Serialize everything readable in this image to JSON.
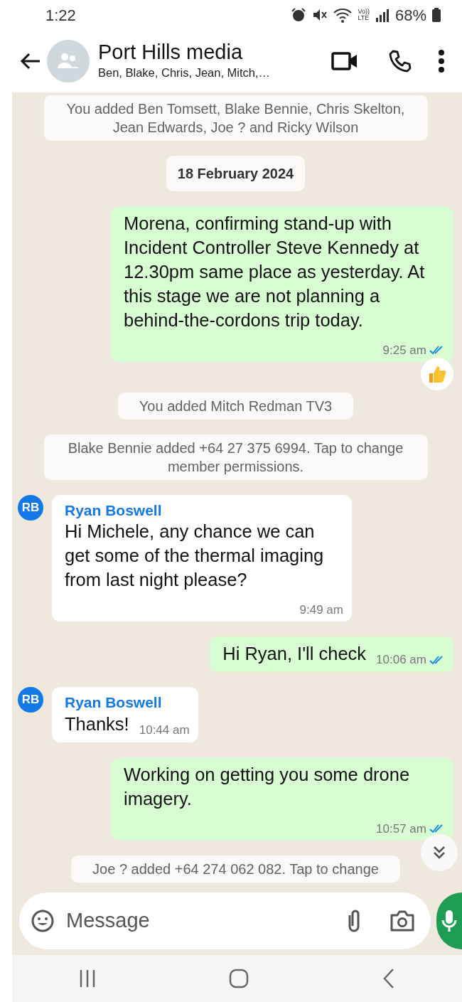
{
  "status_bar": {
    "time": "1:22",
    "network": [
      "Vo))",
      "LTE"
    ],
    "battery": "68%"
  },
  "header": {
    "title": "Port Hills media",
    "subtitle": "Ben, Blake, Chris, Jean, Mitch,…"
  },
  "messages": [
    {
      "kind": "system",
      "text": "You added Ben Tomsett, Blake Bennie, Chris Skelton, Jean Edwards, Joe ? and Ricky Wilson"
    },
    {
      "kind": "date",
      "text": "18 February 2024"
    },
    {
      "kind": "outgoing",
      "text": "Morena, confirming stand-up with Incident Controller Steve Kennedy at 12.30pm same place as yesterday. At this stage we are not planning a behind-the-cordons trip today.",
      "time": "9:25 am",
      "read": true,
      "reaction": true
    },
    {
      "kind": "system",
      "text": "You added Mitch Redman TV3"
    },
    {
      "kind": "system",
      "text": "Blake Bennie added +64 27 375 6994. Tap to change member permissions."
    },
    {
      "kind": "incoming",
      "avatar": "RB",
      "sender": "Ryan Boswell",
      "text": "Hi Michele, any chance we can get some of the thermal imaging from last night please?",
      "time": "9:49 am"
    },
    {
      "kind": "outgoing",
      "text": "Hi Ryan, I'll check",
      "time": "10:06 am",
      "read": true,
      "reaction": false
    },
    {
      "kind": "incoming",
      "avatar": "RB",
      "sender": "Ryan Boswell",
      "text": "Thanks!",
      "time": "10:44 am"
    },
    {
      "kind": "outgoing",
      "text": "Working on getting you some drone imagery.",
      "time": "10:57 am",
      "read": true,
      "reaction": false
    },
    {
      "kind": "system",
      "text": "Joe ? added +64 274 062 082. Tap to change"
    }
  ],
  "composer": {
    "placeholder": "Message"
  }
}
